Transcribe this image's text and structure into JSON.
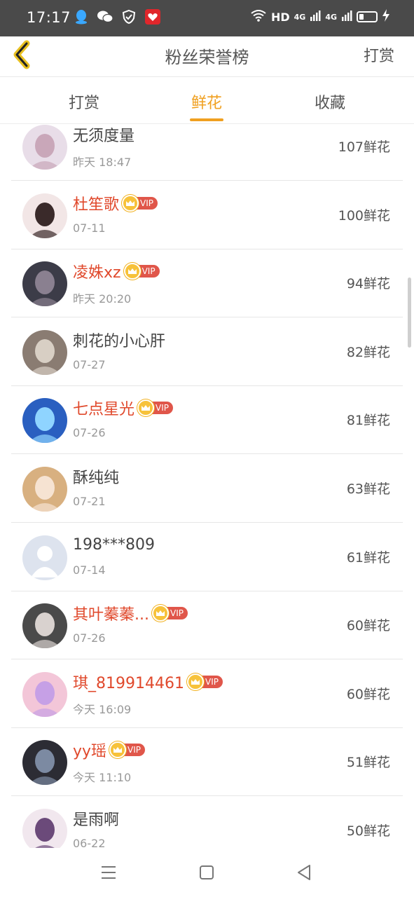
{
  "status_bar": {
    "time": "17:17",
    "left_icons": [
      "qq-icon",
      "wechat-icon",
      "shield-icon",
      "app-notification-icon"
    ],
    "hd": "HD",
    "net1": "4G",
    "net2": "4G"
  },
  "header": {
    "title": "粉丝荣誉榜",
    "action": "打赏"
  },
  "tabs": [
    {
      "label": "打赏"
    },
    {
      "label": "鲜花"
    },
    {
      "label": "收藏"
    }
  ],
  "active_tab": "鲜花",
  "accent_color": "#f0a020",
  "vip_color": "#e0492c",
  "vip_label": "VIP",
  "fans": [
    {
      "name": "无须度量",
      "date": "昨天 18:47",
      "amount": "107鲜花",
      "vip": false
    },
    {
      "name": "杜笙歌",
      "date": "07-11",
      "amount": "100鲜花",
      "vip": true
    },
    {
      "name": "凌姝xz",
      "date": "昨天 20:20",
      "amount": "94鲜花",
      "vip": true
    },
    {
      "name": "刺花的小心肝",
      "date": "07-27",
      "amount": "82鲜花",
      "vip": false
    },
    {
      "name": "七点星光",
      "date": "07-26",
      "amount": "81鲜花",
      "vip": true
    },
    {
      "name": "酥纯纯",
      "date": "07-21",
      "amount": "63鲜花",
      "vip": false
    },
    {
      "name": "198***809",
      "date": "07-14",
      "amount": "61鲜花",
      "vip": false
    },
    {
      "name": "其叶蓁蓁...",
      "date": "07-26",
      "amount": "60鲜花",
      "vip": true
    },
    {
      "name": "琪_819914461",
      "date": "今天 16:09",
      "amount": "60鲜花",
      "vip": true
    },
    {
      "name": "yy瑶",
      "date": "今天 11:10",
      "amount": "51鲜花",
      "vip": true
    },
    {
      "name": "是雨啊",
      "date": "06-22",
      "amount": "50鲜花",
      "vip": false
    }
  ],
  "nav": [
    "menu-icon",
    "home-icon",
    "back-icon"
  ]
}
